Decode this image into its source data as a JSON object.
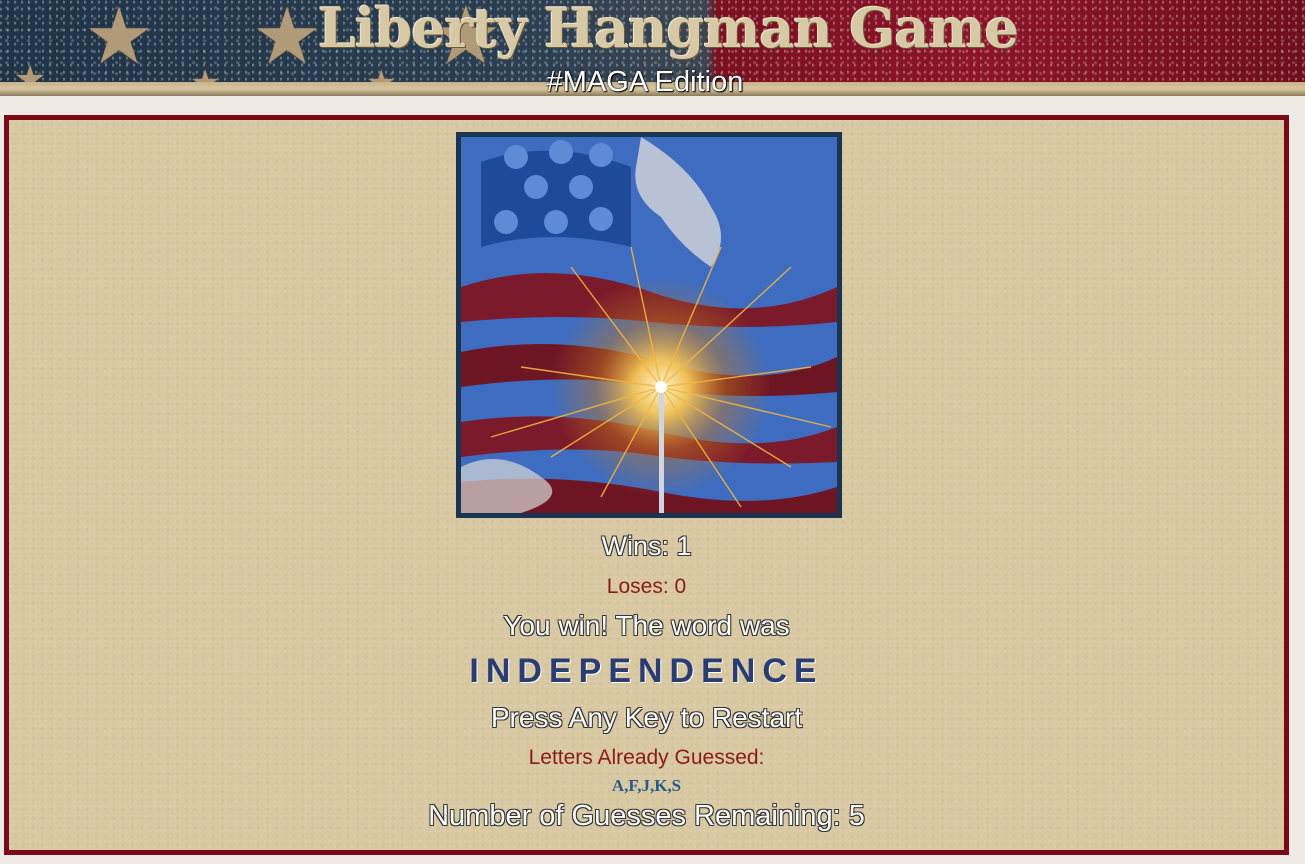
{
  "header": {
    "title": "Liberty Hangman Game",
    "subtitle": "#MAGA Edition"
  },
  "game": {
    "image": "american-flag-sparkler-image",
    "wins_text": "Wins: 1",
    "loses_text": "Loses: 0",
    "result_message": "You win! The word was",
    "word": "INDEPENDENCE",
    "restart_prompt": "Press Any Key to Restart",
    "guessed_label": "Letters Already Guessed:",
    "guessed_letters": "A,F,J,K,S",
    "remaining_text": "Number of Guesses Remaining: 5"
  },
  "colors": {
    "panel_border": "#7a0a1a",
    "panel_background": "#d9c9a3",
    "word": "#2a3d73",
    "red_text": "#8b1a1a"
  }
}
